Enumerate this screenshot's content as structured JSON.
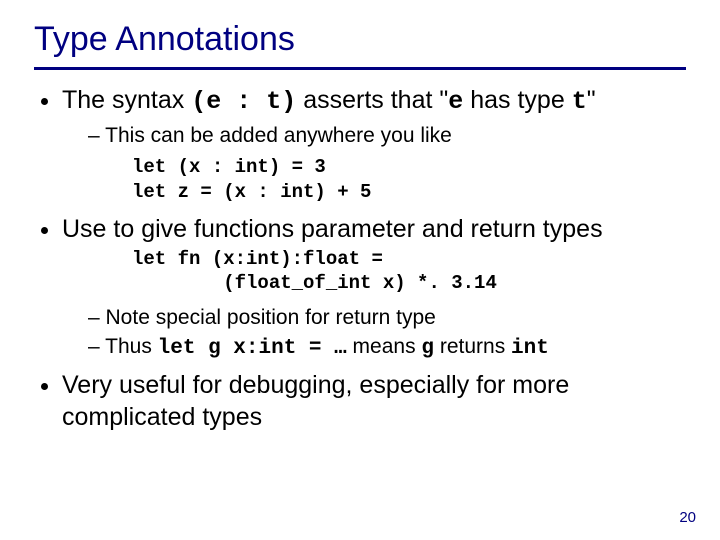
{
  "title": "Type Annotations",
  "b1": {
    "pre": "The syntax ",
    "code1": "(e : t)",
    "mid": " asserts that \"",
    "code2": "e",
    "mid2": " has type ",
    "code3": "t",
    "post": "\""
  },
  "b1_sub1": "This can be added anywhere you like",
  "code1": "let (x : int) = 3\nlet z = (x : int) + 5",
  "b2": "Use to give functions parameter and return types",
  "code2": "let fn (x:int):float =\n        (float_of_int x) *. 3.14",
  "b2_sub1": "Note special position for return type",
  "b2_sub2_pre": "Thus ",
  "b2_sub2_code1": "let g x:int = …",
  "b2_sub2_mid": " means ",
  "b2_sub2_code2": "g",
  "b2_sub2_mid2": " returns ",
  "b2_sub2_code3": "int",
  "b3": "Very useful for debugging, especially for more complicated types",
  "page": "20"
}
